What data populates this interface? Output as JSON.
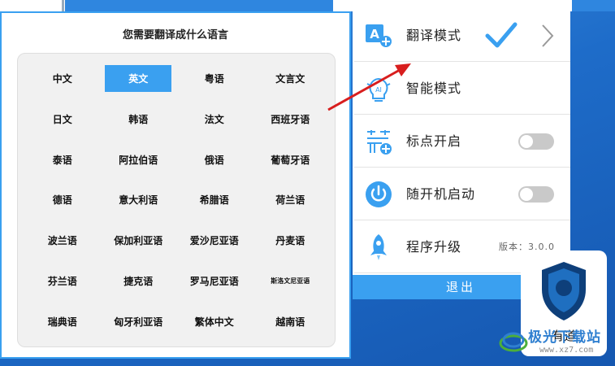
{
  "dialog": {
    "title": "您需要翻译成什么语言",
    "languages": [
      [
        "中文",
        "英文",
        "粤语",
        "文言文"
      ],
      [
        "日文",
        "韩语",
        "法文",
        "西班牙语"
      ],
      [
        "泰语",
        "阿拉伯语",
        "俄语",
        "葡萄牙语"
      ],
      [
        "德语",
        "意大利语",
        "希腊语",
        "荷兰语"
      ],
      [
        "波兰语",
        "保加利亚语",
        "爱沙尼亚语",
        "丹麦语"
      ],
      [
        "芬兰语",
        "捷克语",
        "罗马尼亚语",
        "斯洛文尼亚语"
      ],
      [
        "瑞典语",
        "匈牙利亚语",
        "繁体中文",
        "越南语"
      ]
    ],
    "selected": "英文"
  },
  "menu": {
    "items": [
      {
        "label": "翻译模式",
        "icon": "translate-icon",
        "checked": true
      },
      {
        "label": "智能模式",
        "icon": "ai-bulb-icon"
      },
      {
        "label": "标点开启",
        "icon": "punctuation-icon",
        "toggle": false
      },
      {
        "label": "随开机启动",
        "icon": "power-icon",
        "toggle": false
      },
      {
        "label": "程序升级",
        "icon": "rocket-icon",
        "version": "版本：3.0.0"
      }
    ],
    "exit_label": "退出"
  },
  "desktop": {
    "app_label": "有道",
    "watermark_text": "极光下载站",
    "watermark_url": "www.xz7.com"
  },
  "colors": {
    "accent": "#3aa0f0",
    "desktop": "#1e6cc9",
    "annotation_arrow": "#d81e1e"
  }
}
